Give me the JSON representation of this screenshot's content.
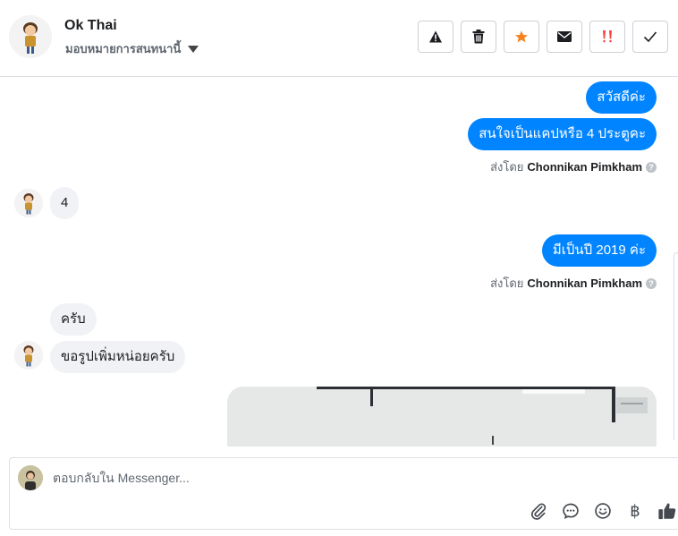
{
  "header": {
    "contact_name": "Ok Thai",
    "assign_label": "มอบหมายการสนทนานี้",
    "actions": [
      {
        "name": "report-spam-button",
        "icon": "warning-icon",
        "color": "#1c1e21"
      },
      {
        "name": "delete-button",
        "icon": "trash-icon",
        "color": "#1c1e21"
      },
      {
        "name": "star-button",
        "icon": "star-icon",
        "color": "#f5821f"
      },
      {
        "name": "mark-unread-button",
        "icon": "envelope-icon",
        "color": "#1c1e21"
      },
      {
        "name": "follow-up-button",
        "icon": "double-exclamation-icon",
        "color": "#fa3e3e"
      },
      {
        "name": "mark-done-button",
        "icon": "checkmark-icon",
        "color": "#1c1e21"
      }
    ]
  },
  "conversation": {
    "messages": [
      {
        "direction": "outgoing",
        "text": "สวัสดีค่ะ"
      },
      {
        "direction": "outgoing",
        "text": "สนใจเป็นแคปหรือ 4 ประตูคะ"
      },
      {
        "direction": "incoming",
        "text": "4"
      },
      {
        "direction": "outgoing",
        "text": "มีเป็นปี 2019 ค่ะ"
      },
      {
        "direction": "incoming",
        "text": "ครับ"
      },
      {
        "direction": "incoming",
        "text": "ขอรูปเพิ่มหน่อยครับ"
      }
    ],
    "sent_by_prefix": "ส่งโดย",
    "sent_by_name": "Chonnikan Pimkham",
    "help_glyph": "?"
  },
  "composer": {
    "placeholder": "ตอบกลับใน Messenger...",
    "value": "",
    "tools": [
      "paperclip-icon",
      "saved-reply-icon",
      "emoji-icon",
      "baht-payment-icon",
      "thumbs-up-icon"
    ],
    "baht_glyph": "฿"
  },
  "colors": {
    "accent": "#0084ff",
    "incoming_bubble": "#f0f2f5",
    "star": "#f5821f",
    "follow_up": "#fa3e3e"
  }
}
